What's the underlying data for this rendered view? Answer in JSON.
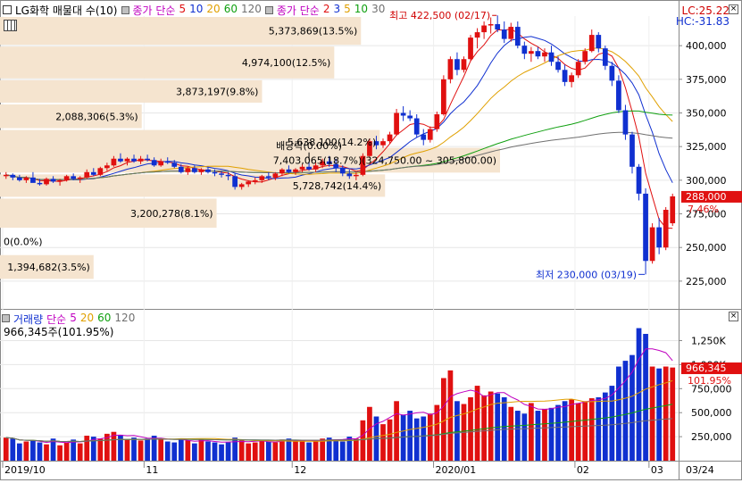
{
  "header": {
    "title": "LG화학 매물대 수(10)",
    "ma_label": "종가 단순",
    "ma_periods": [
      "5",
      "10",
      "20",
      "60",
      "120"
    ],
    "ma_colors": [
      "#e01010",
      "#1030d0",
      "#e0a000",
      "#10a010",
      "#707070"
    ],
    "ma2_label": "종가 단순",
    "ma2_periods": [
      "2",
      "3",
      "5",
      "10",
      "30"
    ],
    "ma2_colors": [
      "#e01010",
      "#1030d0",
      "#e0a000",
      "#10a010",
      "#707070"
    ],
    "lc": "LC:25.22",
    "hc": "HC:-31.83"
  },
  "volume_header": {
    "title": "거래량",
    "ma_label": "단순",
    "ma_periods": [
      "5",
      "20",
      "60",
      "120"
    ],
    "ma_colors": [
      "#c000c0",
      "#e0a000",
      "#10a010",
      "#707070"
    ],
    "subtitle": "966,345주(101.95%)"
  },
  "chart_data": [
    {
      "type": "candlestick",
      "title": "LG화학 매물대 수(10)",
      "y_ticks": [
        "400,000",
        "375,000",
        "350,000",
        "325,000",
        "300,000",
        "275,000",
        "250,000",
        "225,000"
      ],
      "y_tick_values": [
        400000,
        375000,
        350000,
        325000,
        300000,
        275000,
        250000,
        225000
      ],
      "ylim": [
        207000,
        422000
      ],
      "x_ticks": [
        "2019/10",
        "11",
        "12",
        "2020/01",
        "02",
        "03",
        "03/24"
      ],
      "current_price": "288,000",
      "current_change": "7.46%",
      "high_annotation": "최고 422,500 (02/17)",
      "low_annotation": "최저 230,000 (03/19)",
      "dividend_annotation": "배당락(0.00%)",
      "volume_profile": [
        {
          "label": "5,373,869(13.5%)",
          "lo": 400000,
          "hi": 422000,
          "fraction": 0.135
        },
        {
          "label": "4,974,100(12.5%)",
          "lo": 375000,
          "hi": 400000,
          "fraction": 0.125
        },
        {
          "label": "3,873,197(9.8%)",
          "lo": 357000,
          "hi": 375000,
          "fraction": 0.098
        },
        {
          "label": "2,088,306(5.3%)",
          "lo": 338000,
          "hi": 357000,
          "fraction": 0.053
        },
        {
          "label": "5,638,100(14.2%)",
          "lo": 319000,
          "hi": 338000,
          "fraction": 0.142
        },
        {
          "label": "7,403,065(18.7%)(324,750.00 ~ 305,800.00)",
          "lo": 305000,
          "hi": 324750,
          "fraction": 0.187
        },
        {
          "label": "5,728,742(14.4%)",
          "lo": 287000,
          "hi": 305000,
          "fraction": 0.144
        },
        {
          "label": "3,200,278(8.1%)",
          "lo": 264000,
          "hi": 287000,
          "fraction": 0.081
        },
        {
          "label": "0(0.0%)",
          "lo": 245000,
          "hi": 264000,
          "fraction": 0.0
        },
        {
          "label": "1,394,682(3.5%)",
          "lo": 226000,
          "hi": 245000,
          "fraction": 0.035
        }
      ],
      "candles": [
        [
          303000,
          306000,
          301000,
          304000
        ],
        [
          304000,
          305000,
          300000,
          302000
        ],
        [
          302000,
          304000,
          299000,
          300000
        ],
        [
          300000,
          303000,
          298000,
          302000
        ],
        [
          302000,
          306000,
          300000,
          298000
        ],
        [
          298000,
          301000,
          296000,
          297000
        ],
        [
          297000,
          302000,
          296000,
          301000
        ],
        [
          301000,
          303000,
          298000,
          299000
        ],
        [
          299000,
          301000,
          296000,
          300000
        ],
        [
          300000,
          304000,
          299000,
          303000
        ],
        [
          303000,
          305000,
          300000,
          301000
        ],
        [
          301000,
          303000,
          298000,
          302000
        ],
        [
          302000,
          308000,
          301000,
          306000
        ],
        [
          306000,
          309000,
          303000,
          304000
        ],
        [
          304000,
          310000,
          303000,
          309000
        ],
        [
          309000,
          313000,
          307000,
          311000
        ],
        [
          311000,
          318000,
          310000,
          316000
        ],
        [
          316000,
          320000,
          313000,
          314000
        ],
        [
          314000,
          317000,
          311000,
          316000
        ],
        [
          316000,
          319000,
          313000,
          314000
        ],
        [
          314000,
          318000,
          312000,
          316000
        ],
        [
          316000,
          319000,
          314000,
          315000
        ],
        [
          315000,
          317000,
          310000,
          311000
        ],
        [
          311000,
          316000,
          310000,
          314000
        ],
        [
          314000,
          317000,
          312000,
          313000
        ],
        [
          313000,
          315000,
          309000,
          310000
        ],
        [
          310000,
          312000,
          305000,
          306000
        ],
        [
          306000,
          310000,
          304000,
          309000
        ],
        [
          309000,
          311000,
          305000,
          306000
        ],
        [
          306000,
          309000,
          304000,
          308000
        ],
        [
          308000,
          310000,
          305000,
          306000
        ],
        [
          306000,
          308000,
          303000,
          305000
        ],
        [
          305000,
          307000,
          302000,
          304000
        ],
        [
          304000,
          306000,
          300000,
          303000
        ],
        [
          303000,
          305000,
          293000,
          295000
        ],
        [
          295000,
          298000,
          293000,
          297000
        ],
        [
          297000,
          300000,
          295000,
          299000
        ],
        [
          299000,
          302000,
          297000,
          300000
        ],
        [
          300000,
          304000,
          298000,
          303000
        ],
        [
          303000,
          306000,
          300000,
          302000
        ],
        [
          302000,
          306000,
          300000,
          305000
        ],
        [
          305000,
          309000,
          303000,
          308000
        ],
        [
          308000,
          311000,
          305000,
          306000
        ],
        [
          306000,
          309000,
          304000,
          308000
        ],
        [
          308000,
          312000,
          306000,
          310000
        ],
        [
          310000,
          314000,
          307000,
          308000
        ],
        [
          308000,
          313000,
          306000,
          311000
        ],
        [
          311000,
          316000,
          309000,
          314000
        ],
        [
          314000,
          318000,
          310000,
          312000
        ],
        [
          312000,
          316000,
          306000,
          309000
        ],
        [
          309000,
          311000,
          303000,
          305000
        ],
        [
          305000,
          308000,
          301000,
          303000
        ],
        [
          303000,
          306000,
          300000,
          304000
        ],
        [
          304000,
          320000,
          303000,
          318000
        ],
        [
          318000,
          331000,
          317000,
          329000
        ],
        [
          329000,
          333000,
          323000,
          326000
        ],
        [
          326000,
          331000,
          324000,
          329000
        ],
        [
          329000,
          336000,
          327000,
          334000
        ],
        [
          334000,
          353000,
          333000,
          350000
        ],
        [
          350000,
          355000,
          344000,
          348000
        ],
        [
          348000,
          352000,
          344000,
          346000
        ],
        [
          346000,
          349000,
          332000,
          334000
        ],
        [
          334000,
          338000,
          326000,
          330000
        ],
        [
          330000,
          340000,
          328000,
          338000
        ],
        [
          338000,
          351000,
          336000,
          349000
        ],
        [
          349000,
          378000,
          348000,
          375000
        ],
        [
          375000,
          392000,
          372000,
          390000
        ],
        [
          390000,
          395000,
          378000,
          382000
        ],
        [
          382000,
          392000,
          380000,
          390000
        ],
        [
          390000,
          408000,
          389000,
          406000
        ],
        [
          406000,
          413000,
          398000,
          410000
        ],
        [
          410000,
          418000,
          405000,
          415000
        ],
        [
          415000,
          421000,
          409000,
          416000
        ],
        [
          416000,
          422500,
          410000,
          412000
        ],
        [
          412000,
          418000,
          402000,
          405000
        ],
        [
          405000,
          417000,
          403000,
          414000
        ],
        [
          414000,
          418000,
          398000,
          400000
        ],
        [
          400000,
          403000,
          390000,
          394000
        ],
        [
          394000,
          399000,
          388000,
          396000
        ],
        [
          396000,
          399000,
          390000,
          392000
        ],
        [
          392000,
          398000,
          388000,
          395000
        ],
        [
          395000,
          400000,
          385000,
          388000
        ],
        [
          388000,
          392000,
          380000,
          382000
        ],
        [
          382000,
          386000,
          370000,
          373000
        ],
        [
          373000,
          380000,
          369000,
          378000
        ],
        [
          378000,
          390000,
          376000,
          388000
        ],
        [
          388000,
          398000,
          386000,
          396000
        ],
        [
          396000,
          412000,
          395000,
          408000
        ],
        [
          408000,
          410000,
          395000,
          398000
        ],
        [
          398000,
          400000,
          382000,
          385000
        ],
        [
          385000,
          388000,
          370000,
          374000
        ],
        [
          374000,
          378000,
          350000,
          352000
        ],
        [
          352000,
          356000,
          330000,
          334000
        ],
        [
          334000,
          336000,
          305000,
          310000
        ],
        [
          310000,
          312000,
          285000,
          290000
        ],
        [
          290000,
          294000,
          230000,
          240000
        ],
        [
          240000,
          268000,
          238000,
          265000
        ],
        [
          265000,
          272000,
          245000,
          250000
        ],
        [
          250000,
          280000,
          248000,
          278000
        ],
        [
          268000,
          290000,
          266000,
          288000
        ]
      ]
    },
    {
      "type": "bar",
      "title": "거래량",
      "y_ticks": [
        "1,250K",
        "1,000K",
        "750,000",
        "500,000",
        "250,000"
      ],
      "y_tick_values": [
        1250000,
        1000000,
        750000,
        500000,
        250000
      ],
      "ylim": [
        0,
        1450000
      ],
      "current_volume": "966,345",
      "current_ratio": "101.95%",
      "volumes": [
        240000,
        230000,
        180000,
        200000,
        210000,
        190000,
        170000,
        230000,
        160000,
        190000,
        220000,
        180000,
        260000,
        250000,
        230000,
        280000,
        300000,
        270000,
        220000,
        240000,
        210000,
        230000,
        260000,
        230000,
        200000,
        190000,
        230000,
        210000,
        180000,
        220000,
        200000,
        190000,
        170000,
        190000,
        240000,
        210000,
        180000,
        190000,
        210000,
        200000,
        190000,
        220000,
        230000,
        200000,
        210000,
        190000,
        210000,
        230000,
        240000,
        220000,
        200000,
        250000,
        230000,
        420000,
        560000,
        460000,
        380000,
        430000,
        620000,
        480000,
        520000,
        440000,
        460000,
        490000,
        580000,
        860000,
        940000,
        620000,
        590000,
        660000,
        780000,
        680000,
        720000,
        700000,
        660000,
        560000,
        520000,
        490000,
        600000,
        520000,
        540000,
        550000,
        580000,
        620000,
        640000,
        600000,
        620000,
        650000,
        660000,
        710000,
        780000,
        980000,
        1040000,
        1100000,
        1380000,
        1320000,
        980000,
        960000,
        980000,
        970000
      ]
    }
  ]
}
